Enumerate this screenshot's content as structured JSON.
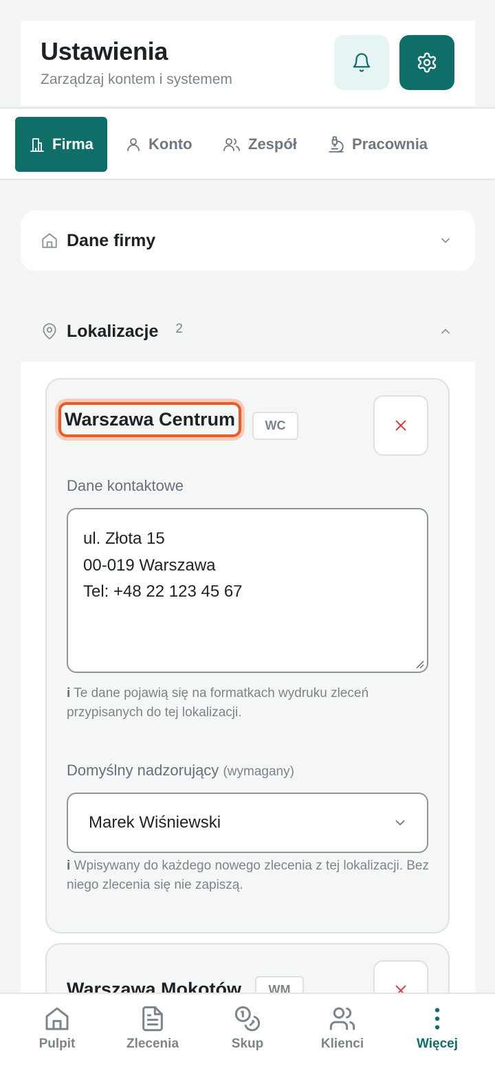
{
  "header": {
    "title": "Ustawienia",
    "subtitle": "Zarządzaj kontem i systemem",
    "notifications_icon": "bell-icon",
    "settings_icon": "gear-icon"
  },
  "tabs": [
    {
      "label": "Firma",
      "icon": "building-icon",
      "active": true
    },
    {
      "label": "Konto",
      "icon": "user-icon",
      "active": false
    },
    {
      "label": "Zespół",
      "icon": "users-icon",
      "active": false
    },
    {
      "label": "Pracownia",
      "icon": "microscope-icon",
      "active": false
    }
  ],
  "company_section": {
    "title": "Dane firmy",
    "icon": "home-icon",
    "expanded": false
  },
  "locations_section": {
    "title": "Lokalizacje",
    "count": "2",
    "icon": "map-pin-icon",
    "expanded": true
  },
  "locations": [
    {
      "name": "Warszawa Centrum",
      "code": "WC",
      "contact_label": "Dane kontaktowe",
      "contact_lines": [
        "ul. Złota 15",
        "00-019 Warszawa",
        "Tel: +48 22 123 45 67"
      ],
      "contact_hint_prefix": "i",
      "contact_hint": "Te dane pojawią się na formatkach wydruku zleceń przypisanych do tej lokalizacji.",
      "supervisor_label": "Domyślny nadzorujący",
      "supervisor_required": "(wymagany)",
      "supervisor_value": "Marek Wiśniewski",
      "supervisor_hint_prefix": "i",
      "supervisor_hint": "Wpisywany do każdego nowego zlecenia z tej lokalizacji. Bez niego zlecenia się nie zapiszą."
    },
    {
      "name": "Warszawa Mokotów",
      "code": "WM"
    }
  ],
  "bottom_nav": [
    {
      "label": "Pulpit",
      "icon": "home-icon",
      "active": false
    },
    {
      "label": "Zlecenia",
      "icon": "document-icon",
      "active": false
    },
    {
      "label": "Skup",
      "icon": "coins-icon",
      "active": false
    },
    {
      "label": "Klienci",
      "icon": "users-icon",
      "active": false
    },
    {
      "label": "Więcej",
      "icon": "more-vertical-icon",
      "active": true
    }
  ],
  "colors": {
    "primary": "#0f6e68",
    "primary_light": "#e6f5f3",
    "focus_ring": "#ef5a24",
    "delete": "#d63b3b",
    "background": "#f4f6f5"
  }
}
